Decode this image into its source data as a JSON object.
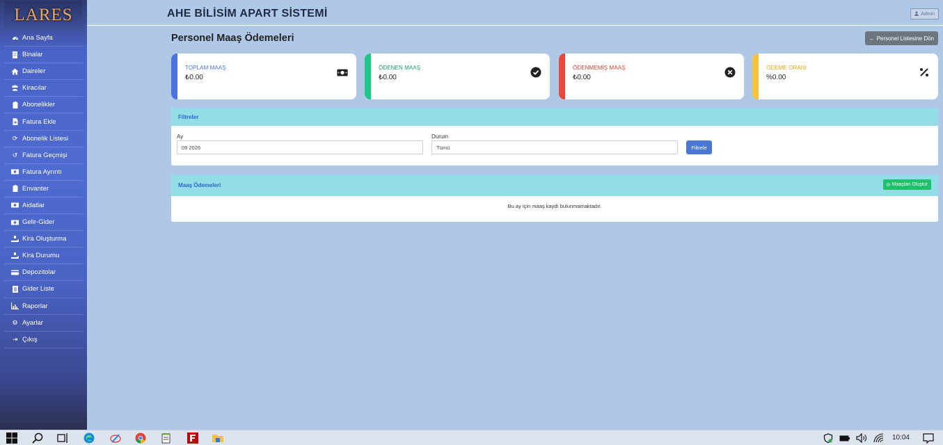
{
  "sidebar": {
    "logo": "LARES",
    "items": [
      {
        "label": "Ana Sayfa",
        "icon": "dashboard-icon"
      },
      {
        "label": "Binalar",
        "icon": "building-icon"
      },
      {
        "label": "Daireler",
        "icon": "home-icon"
      },
      {
        "label": "Kiracılar",
        "icon": "users-icon"
      },
      {
        "label": "Abonelikler",
        "icon": "clipboard-icon"
      },
      {
        "label": "Fatura Ekle",
        "icon": "file-plus-icon"
      },
      {
        "label": "Abonelik Listesi",
        "icon": "sync-icon"
      },
      {
        "label": "Fatura Geçmişi",
        "icon": "history-icon"
      },
      {
        "label": "Fatura Ayrıntı",
        "icon": "money-icon"
      },
      {
        "label": "Envanter",
        "icon": "clipboard-icon"
      },
      {
        "label": "Aidatlar",
        "icon": "money-icon"
      },
      {
        "label": "Gelir-Gider",
        "icon": "money-icon"
      },
      {
        "label": "Kira Oluşturma",
        "icon": "hand-money-icon"
      },
      {
        "label": "Kira Durumu",
        "icon": "hand-money-icon"
      },
      {
        "label": "Depozitolar",
        "icon": "card-icon"
      },
      {
        "label": "Gider Liste",
        "icon": "list-icon"
      },
      {
        "label": "Raporlar",
        "icon": "chart-icon"
      },
      {
        "label": "Ayarlar",
        "icon": "gear-icon"
      },
      {
        "label": "Çıkış",
        "icon": "logout-icon"
      }
    ]
  },
  "header": {
    "title": "AHE BİLİSİM APART SİSTEMİ",
    "user": "Admin"
  },
  "page": {
    "title": "Personel Maaş Ödemeleri",
    "back_button": "Personel Listesine Dön"
  },
  "cards": [
    {
      "label": "TOPLAM MAAŞ",
      "value": "₺0.00",
      "color": "#4e73df",
      "icon": "money-bill-icon"
    },
    {
      "label": "ÖDENEN MAAŞ",
      "value": "₺0.00",
      "color": "#1cc88a",
      "icon": "check-circle-icon"
    },
    {
      "label": "ÖDENMEMİŞ MAAŞ",
      "value": "₺0.00",
      "color": "#e74a3b",
      "icon": "times-circle-icon"
    },
    {
      "label": "ÖDEME ORANI",
      "value": "%0.00",
      "color": "#f6c23e",
      "icon": "percent-icon"
    }
  ],
  "filters": {
    "title": "Filtreler",
    "month_label": "Ay",
    "month_value": "09 2026",
    "status_label": "Durum",
    "status_value": "Tümü",
    "button": "Filtrele"
  },
  "payments": {
    "title": "Maaş Ödemeleri",
    "create_button": "Maaşları Oluştur",
    "empty_message": "Bu ay için maaş kaydı bulunmamaktadır."
  },
  "taskbar": {
    "time": "10:04"
  }
}
